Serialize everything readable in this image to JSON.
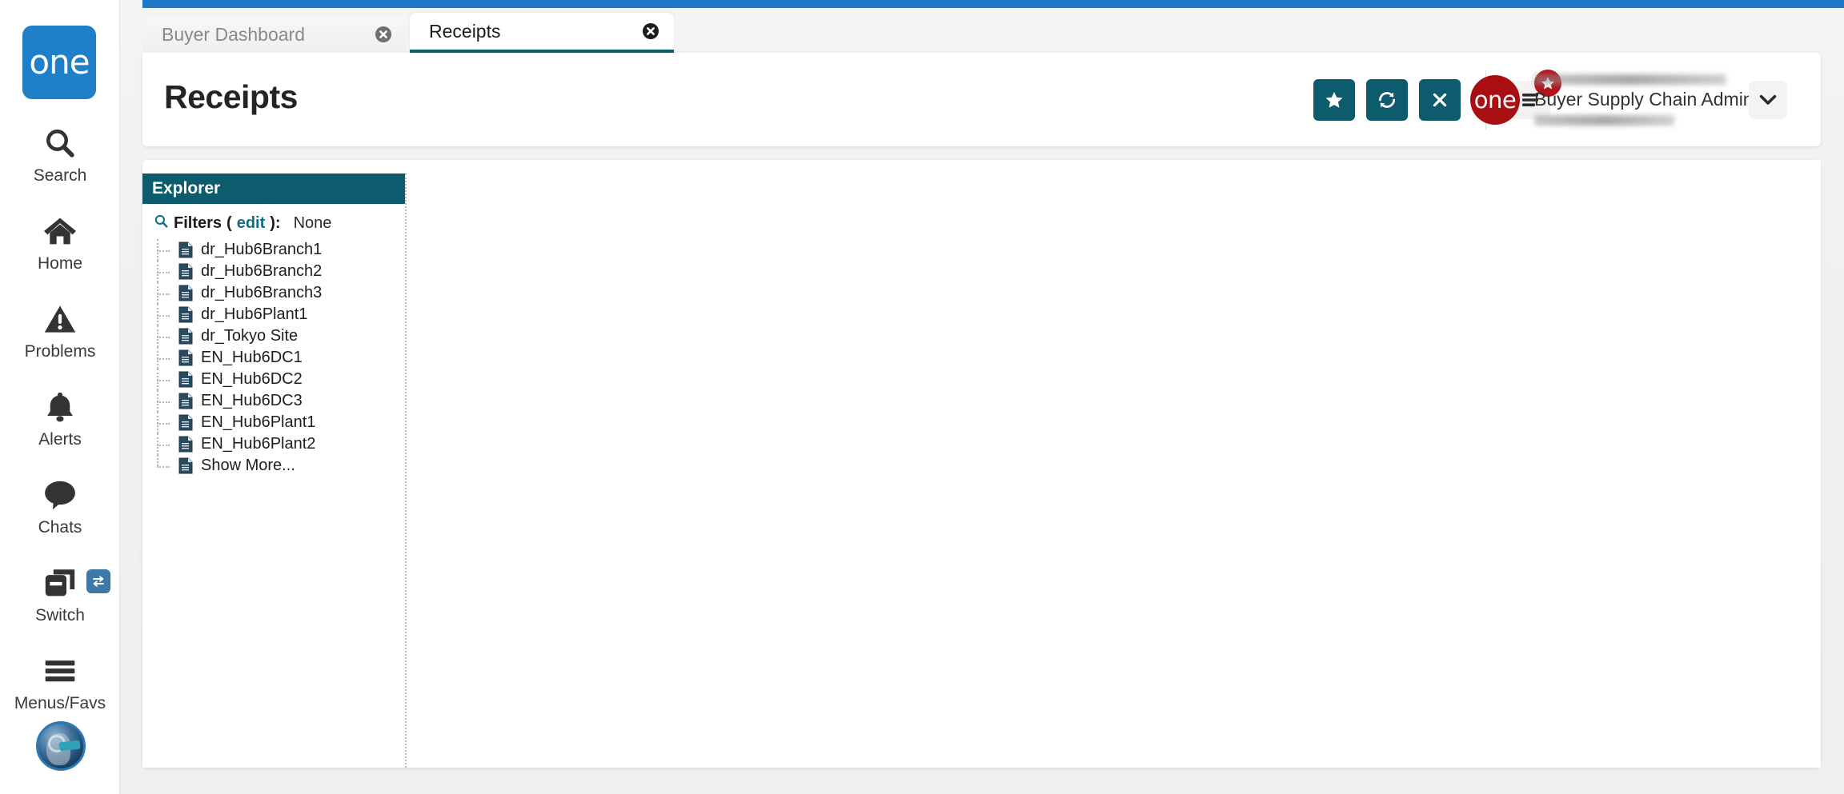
{
  "brand": {
    "logo_text": "one",
    "logo_color": "#1f7fc9",
    "header_logo_color": "#a80e12",
    "accent_teal": "#0c5c6e",
    "accent_blue": "#1b79c8",
    "badge_red": "#b3141b"
  },
  "rail": {
    "items": [
      {
        "label": "Search",
        "icon": "search-icon"
      },
      {
        "label": "Home",
        "icon": "home-icon"
      },
      {
        "label": "Problems",
        "icon": "warning-triangle-icon"
      },
      {
        "label": "Alerts",
        "icon": "bell-icon"
      },
      {
        "label": "Chats",
        "icon": "chat-bubble-icon"
      },
      {
        "label": "Switch",
        "icon": "switch-windows-icon"
      },
      {
        "label": "Menus/Favs",
        "icon": "hamburger-icon"
      }
    ],
    "avatar_icon": "assistant-avatar-icon"
  },
  "tabs": [
    {
      "label": "Buyer Dashboard",
      "active": false,
      "close_icon": "close-circle-icon"
    },
    {
      "label": "Receipts",
      "active": true,
      "close_icon": "close-circle-icon"
    }
  ],
  "header": {
    "title": "Receipts",
    "actions": [
      {
        "name": "favorite-button",
        "icon": "star-icon"
      },
      {
        "name": "refresh-button",
        "icon": "refresh-icon"
      },
      {
        "name": "close-button",
        "icon": "x-icon"
      }
    ],
    "menus_button": {
      "icon": "menu-lines-icon",
      "badge_icon": "star-icon"
    },
    "user": {
      "role": "Buyer Supply Chain Admin",
      "name_redacted": true,
      "org_redacted": true,
      "caret_icon": "chevron-down-icon"
    }
  },
  "explorer": {
    "title": "Explorer",
    "search_icon": "search-icon",
    "filters_label": "Filters",
    "filters_edit_label": "edit",
    "filters_open_paren": "(",
    "filters_close_paren": "):",
    "filters_value": "None",
    "nodes": [
      {
        "label": "dr_Hub6Branch1",
        "icon": "document-icon"
      },
      {
        "label": "dr_Hub6Branch2",
        "icon": "document-icon"
      },
      {
        "label": "dr_Hub6Branch3",
        "icon": "document-icon"
      },
      {
        "label": "dr_Hub6Plant1",
        "icon": "document-icon"
      },
      {
        "label": "dr_Tokyo Site",
        "icon": "document-icon"
      },
      {
        "label": "EN_Hub6DC1",
        "icon": "document-icon"
      },
      {
        "label": "EN_Hub6DC2",
        "icon": "document-icon"
      },
      {
        "label": "EN_Hub6DC3",
        "icon": "document-icon"
      },
      {
        "label": "EN_Hub6Plant1",
        "icon": "document-icon"
      },
      {
        "label": "EN_Hub6Plant2",
        "icon": "document-icon"
      },
      {
        "label": "Show More...",
        "icon": "document-icon"
      }
    ]
  }
}
